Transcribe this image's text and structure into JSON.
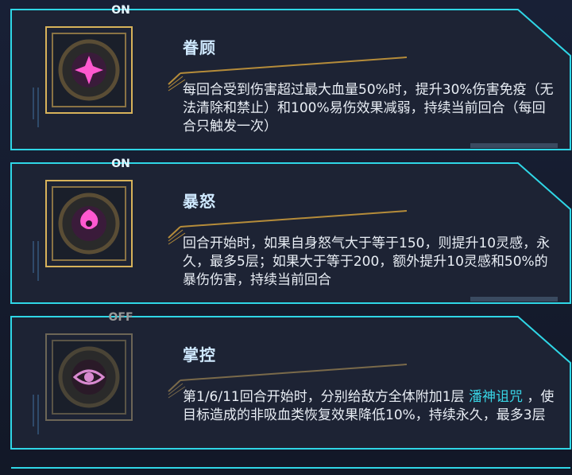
{
  "skills": [
    {
      "status": "ON",
      "name": "眷顾",
      "description": "每回合受到伤害超过最大血量50%时，提升30%伤害免疫（无法清除和禁止）和100%易伤效果减弱，持续当前回合（每回合只触发一次）",
      "icon": "pink-star-gear-icon"
    },
    {
      "status": "ON",
      "name": "暴怒",
      "description": "回合开始时，如果自身怒气大于等于150，则提升10灵感，永久，最多5层；如果大于等于200，额外提升10灵感和50%的暴伤伤害，持续当前回合",
      "icon": "pink-swirl-gear-icon"
    },
    {
      "status": "OFF",
      "name": "掌控",
      "description_prefix": "第1/6/11回合开始时，分别给敌方全体附加1层",
      "description_keyword": "潘神诅咒",
      "description_suffix": "，使目标造成的非吸血类恢复效果降低10%，持续永久，最多3层",
      "icon": "eye-gear-icon"
    }
  ],
  "colors": {
    "frame_cyan": "#2fd6e6",
    "panel_bg": "#1d2334",
    "gold": "#d7b25a",
    "keyword": "#38d6e6"
  }
}
